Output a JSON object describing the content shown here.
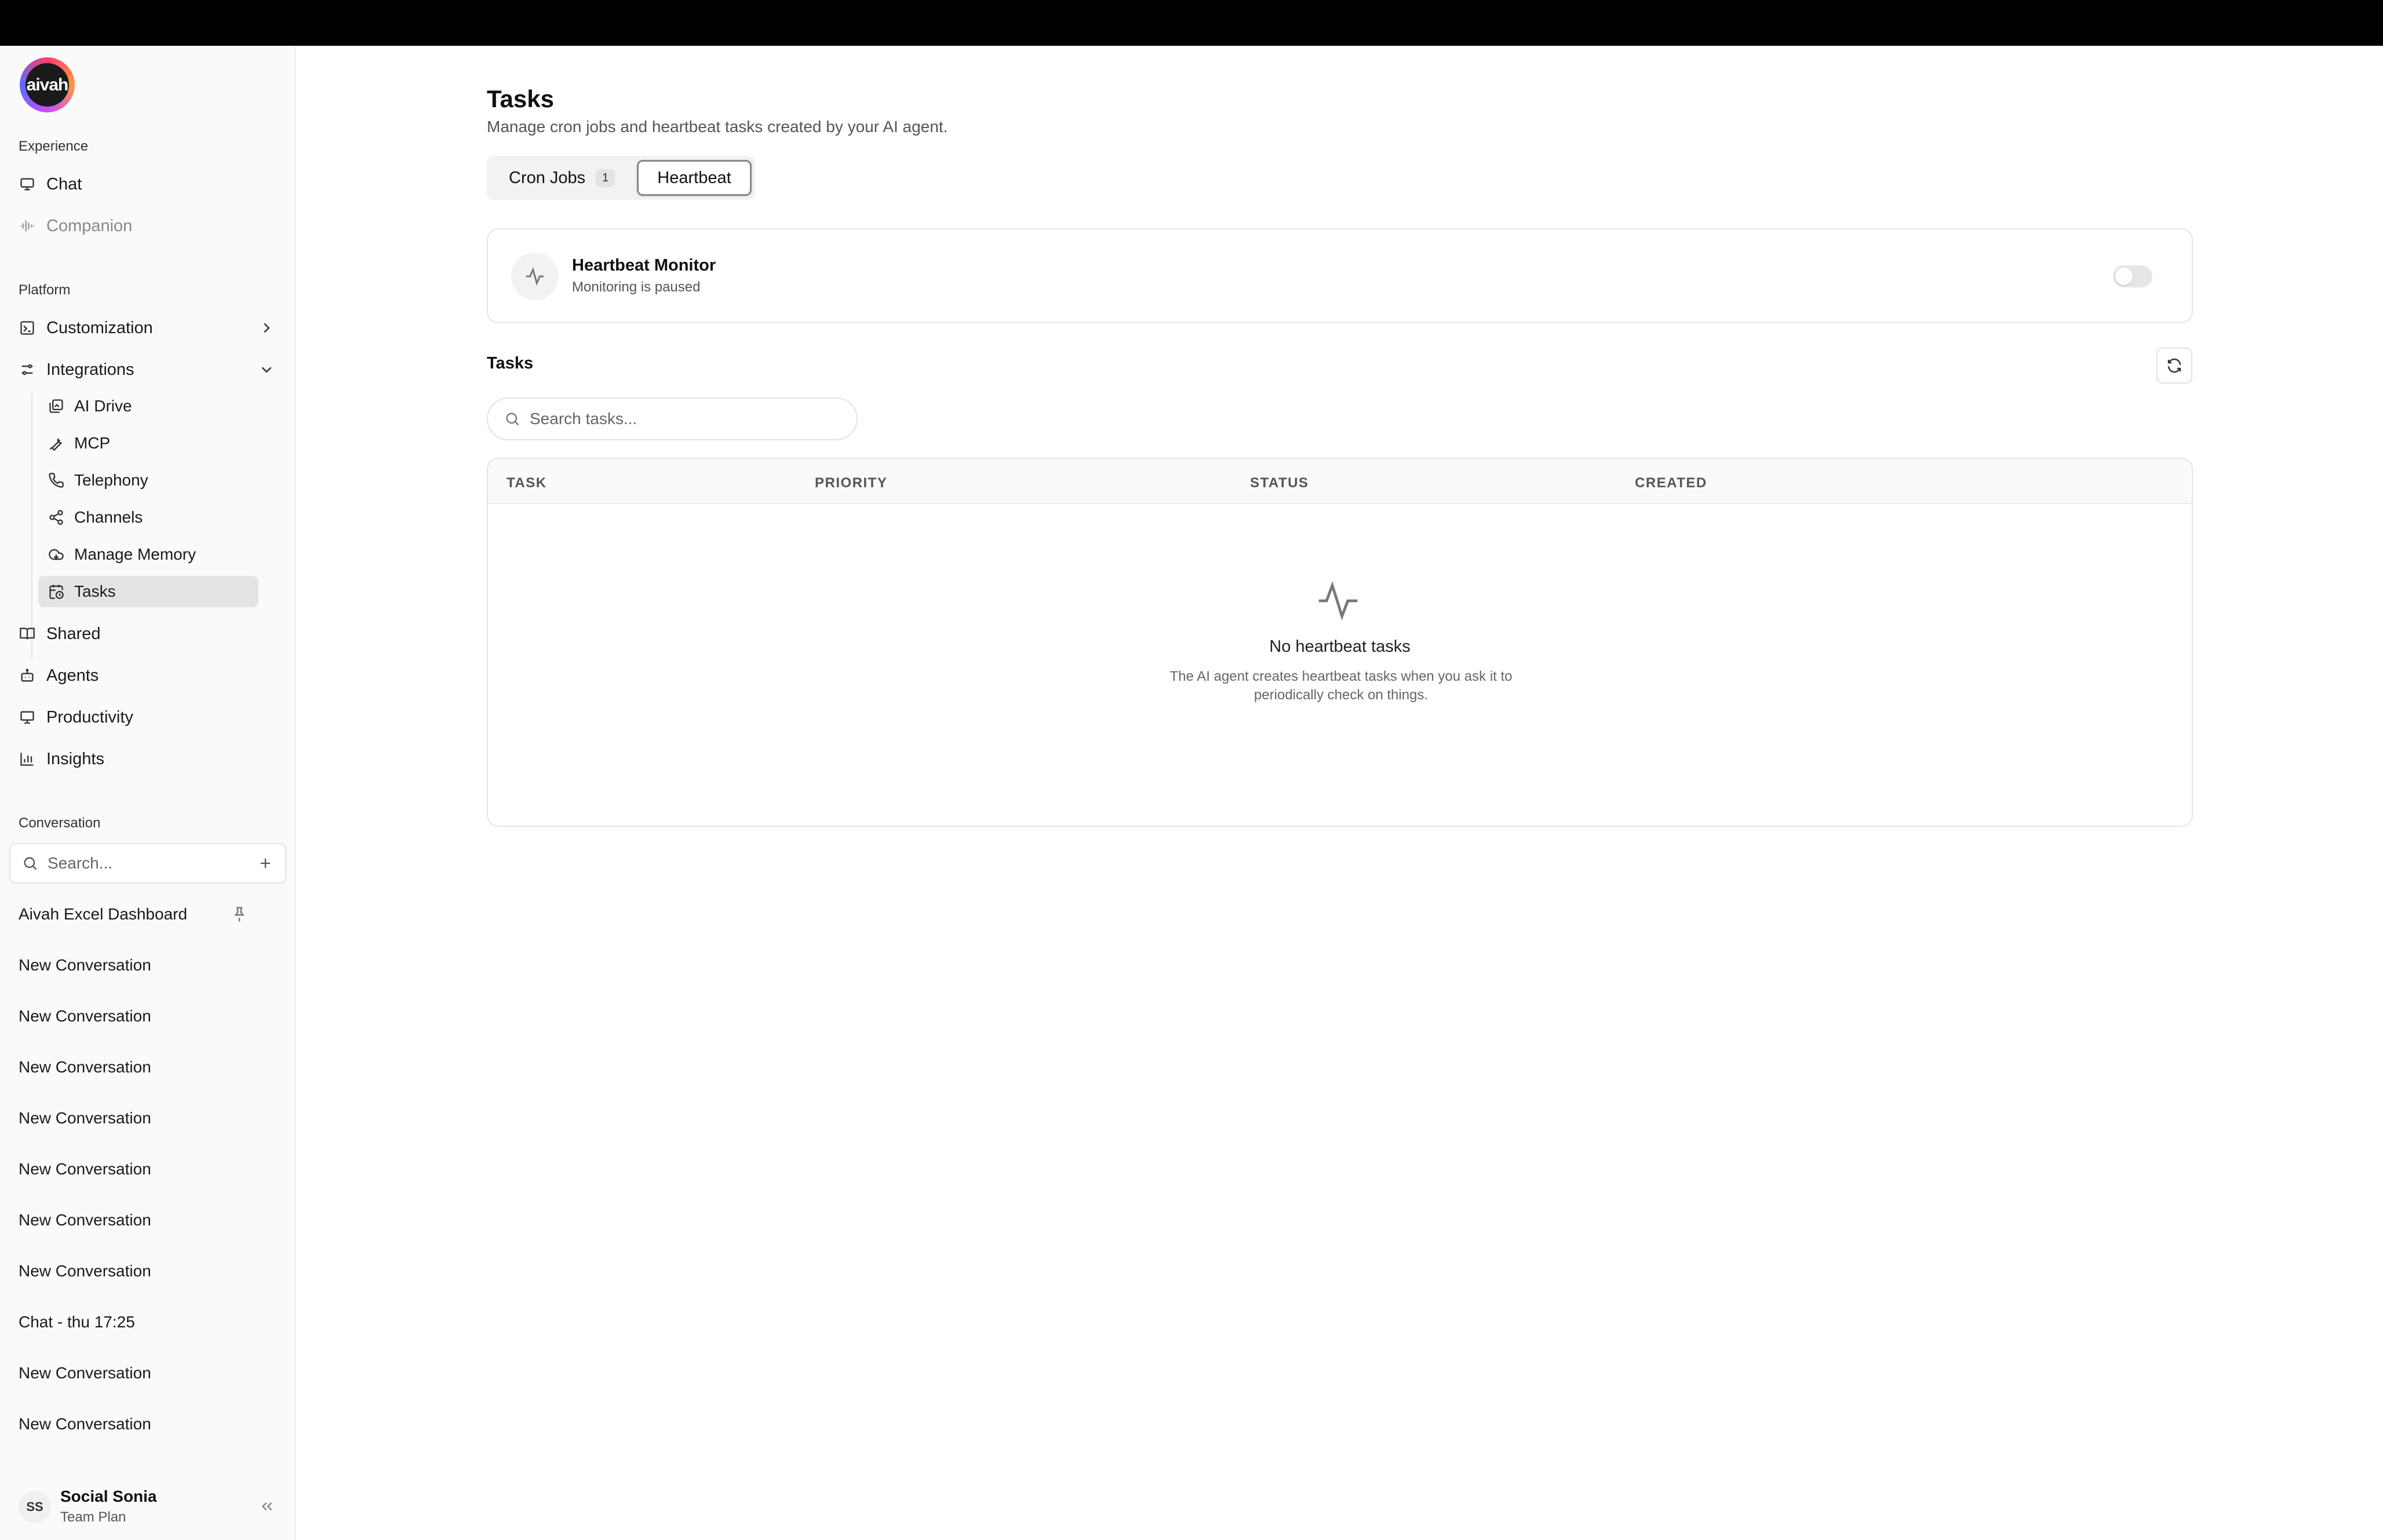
{
  "logo_text": "aivah",
  "sidebar": {
    "experience_label": "Experience",
    "experience_items": [
      {
        "label": "Chat",
        "icon": "monitor-icon"
      },
      {
        "label": "Companion",
        "icon": "waveform-icon"
      }
    ],
    "platform_label": "Platform",
    "platform_items": [
      {
        "label": "Customization",
        "icon": "palette-icon"
      },
      {
        "label": "Integrations",
        "icon": "sliders-icon"
      }
    ],
    "integration_subitems": [
      {
        "label": "AI Drive",
        "icon": "drive-icon"
      },
      {
        "label": "MCP",
        "icon": "wrench-icon"
      },
      {
        "label": "Telephony",
        "icon": "phone-icon"
      },
      {
        "label": "Channels",
        "icon": "share-icon"
      },
      {
        "label": "Manage Memory",
        "icon": "cloud-icon"
      },
      {
        "label": "Tasks",
        "icon": "calendar-clock-icon",
        "active": true
      }
    ],
    "more_items": [
      {
        "label": "Shared",
        "icon": "book-icon"
      },
      {
        "label": "Agents",
        "icon": "bot-icon"
      },
      {
        "label": "Productivity",
        "icon": "presentation-icon"
      },
      {
        "label": "Insights",
        "icon": "bar-chart-icon"
      }
    ],
    "conversation_label": "Conversation",
    "search_placeholder": "Search...",
    "conversations": [
      {
        "title": "Aivah Excel Dashboard",
        "pinned": true
      },
      {
        "title": "New Conversation"
      },
      {
        "title": "New Conversation"
      },
      {
        "title": "New Conversation"
      },
      {
        "title": "New Conversation"
      },
      {
        "title": "New Conversation"
      },
      {
        "title": "New Conversation"
      },
      {
        "title": "New Conversation"
      },
      {
        "title": "Chat - thu 17:25"
      },
      {
        "title": "New Conversation"
      },
      {
        "title": "New Conversation"
      }
    ],
    "user": {
      "initials": "SS",
      "name": "Social Sonia",
      "plan": "Team Plan"
    }
  },
  "main": {
    "title": "Tasks",
    "subtitle": "Manage cron jobs and heartbeat tasks created by your AI agent.",
    "tabs": [
      {
        "label": "Cron Jobs",
        "badge": "1",
        "active": false
      },
      {
        "label": "Heartbeat",
        "active": true
      }
    ],
    "monitor": {
      "title": "Heartbeat Monitor",
      "status": "Monitoring is paused",
      "enabled": false
    },
    "tasks_heading": "Tasks",
    "task_search_placeholder": "Search tasks...",
    "table": {
      "columns": [
        "TASK",
        "PRIORITY",
        "STATUS",
        "CREATED"
      ],
      "empty_title": "No heartbeat tasks",
      "empty_description": "The AI agent creates heartbeat tasks when you ask it to periodically check on things."
    }
  }
}
